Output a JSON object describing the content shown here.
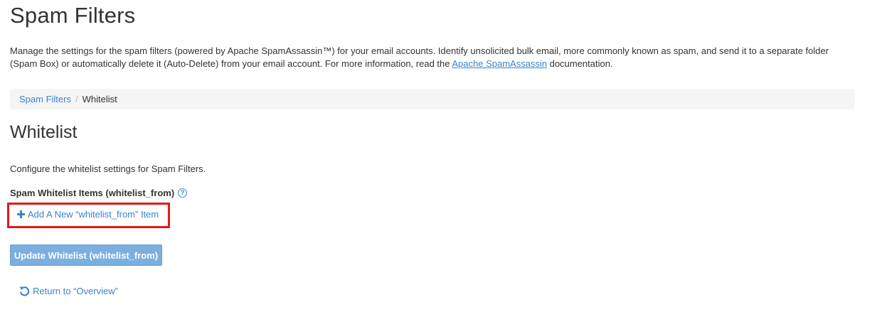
{
  "page": {
    "title": "Spam Filters",
    "intro_text": "Manage the settings for the spam filters (powered by Apache SpamAssassin™) for your email accounts. Identify unsolicited bulk email, more commonly known as spam, and send it to a separate folder (Spam Box) or automatically delete it (Auto-Delete) from your email account. For more information, read the ",
    "intro_link": "Apache SpamAssassin",
    "intro_tail": " documentation."
  },
  "breadcrumb": {
    "parent": "Spam Filters",
    "separator": "/",
    "current": "Whitelist"
  },
  "section": {
    "title": "Whitelist",
    "description": "Configure the whitelist settings for Spam Filters.",
    "field_label": "Spam Whitelist Items (whitelist_from)",
    "help_glyph": "?",
    "add_item_label": "Add A New “whitelist_from” Item",
    "update_button": "Update Whitelist (whitelist_from)",
    "return_label": "Return to “Overview”"
  },
  "icons": {
    "help": "question-circle-icon",
    "add": "plus-icon",
    "return": "undo-icon"
  },
  "colors": {
    "link": "#3a84c9",
    "button_bg": "#7aafe0",
    "highlight_border": "#e0191f",
    "breadcrumb_bg": "#f5f5f5"
  }
}
